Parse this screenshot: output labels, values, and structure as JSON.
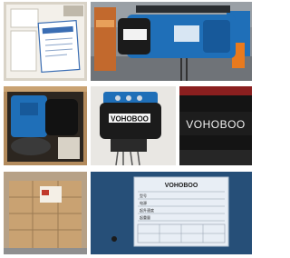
{
  "brand": {
    "logo_text": "VOHOBOO",
    "plate_header": "VOHOBOO"
  },
  "nameplate": {
    "rows": [
      "型号",
      "电源",
      "起升速度",
      "起重量"
    ]
  },
  "colors": {
    "hoist_blue": "#1f6fb8",
    "motor_black": "#1b1b1b",
    "box_wood": "#c9a272",
    "accent_orange": "#e87a1e"
  }
}
